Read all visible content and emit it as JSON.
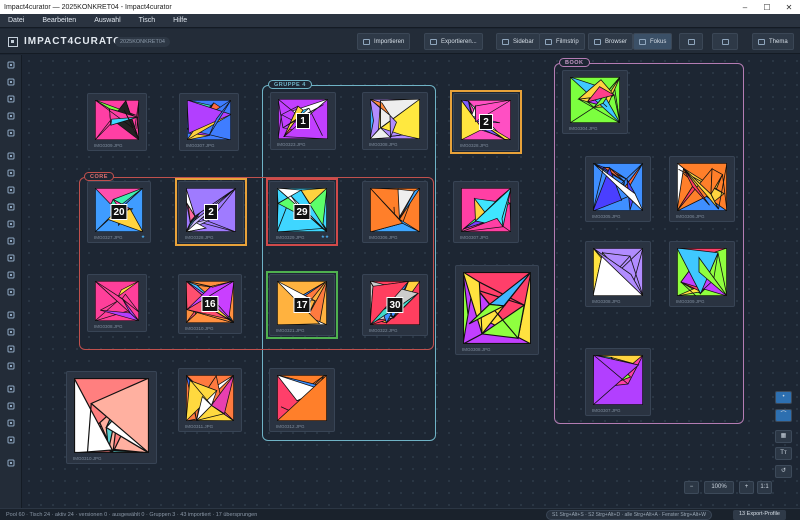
{
  "window": {
    "title": "Impact4curator — 2025KONKRET04 - Impact4curator"
  },
  "menu": [
    "Datei",
    "Bearbeiten",
    "Auswahl",
    "Tisch",
    "Hilfe"
  ],
  "toolbar": {
    "app_name": "IMPACT4CURATOR",
    "project": "2025KONKRET04",
    "import": "Importieren",
    "export": "Exportieren...",
    "views": [
      "Sidebar",
      "Filmstrip",
      "Browser",
      "Fokus"
    ],
    "active_view": "Fokus",
    "theme": "Thema"
  },
  "groups": [
    {
      "label": "GRUPPE 4",
      "color": "#6fb3c6"
    },
    {
      "label": "CORE",
      "color": "#c0504d"
    },
    {
      "label": "BOOK",
      "color": "#b47cb3"
    }
  ],
  "cards": [
    {
      "file": "IMG0309.JPG",
      "palette": [
        "#ff3fa4",
        "#7dff3f",
        "#3fd9ff",
        "#ffe23f",
        "#222222"
      ]
    },
    {
      "file": "IMG0307.JPG",
      "palette": [
        "#3f7dff",
        "#ff6a3f",
        "#ffd13f",
        "#39e0c0",
        "#b23fff"
      ]
    },
    {
      "file": "IMG0323.JPG",
      "badge": "1",
      "palette": [
        "#c23fff",
        "#3fc9ff",
        "#ffd43f",
        "#ff3f6a",
        "#ffffff"
      ]
    },
    {
      "file": "IMG0308.JPG",
      "palette": [
        "#b18cff",
        "#ff8c3f",
        "#ffe83f",
        "#3fb0ff",
        "#eeeeee"
      ]
    },
    {
      "file": "IMG0328.JPG",
      "badge": "2",
      "palette": [
        "#ff4fc3",
        "#7e5cff",
        "#3fd0ff",
        "#ffe43f",
        "#ffffff"
      ]
    },
    {
      "file": "IMG0327.JPG",
      "badge": "20",
      "stars": "★",
      "palette": [
        "#ff4faf",
        "#3ff0b0",
        "#ffd43f",
        "#3f9cff",
        "#ffffff"
      ]
    },
    {
      "file": "IMG0328.JPG",
      "badge": "2",
      "palette": [
        "#9f7bff",
        "#c9b9ff",
        "#3fc4ff",
        "#ff6a9f",
        "#ffffff"
      ]
    },
    {
      "file": "IMG0329.JPG",
      "badge": "29",
      "stars": "★★",
      "palette": [
        "#3fd6ff",
        "#ff3f7a",
        "#ffd23f",
        "#5cff6a",
        "#ffffff"
      ]
    },
    {
      "file": "IMG0306.JPG",
      "palette": [
        "#ff7f2a",
        "#ffc43f",
        "#ff3f3f",
        "#3fa6ff",
        "#eeeeee"
      ]
    },
    {
      "file": "IMG0307.JPG",
      "palette": [
        "#ff3fa4",
        "#ffd43f",
        "#3fe6ff",
        "#7a3fff",
        "#4aff7a"
      ]
    },
    {
      "file": "IMG0308.JPG",
      "palette": [
        "#ff3f9a",
        "#ff9f3f",
        "#ffe03f",
        "#b23fff",
        "#3fffc8"
      ]
    },
    {
      "file": "IMG0310.JPG",
      "badge": "16",
      "palette": [
        "#ff8f3f",
        "#ff4f6f",
        "#ffd93f",
        "#3fb8ff",
        "#c93fff"
      ]
    },
    {
      "file": "IMG0321.JPG",
      "badge": "17",
      "palette": [
        "#ffb23f",
        "#ffe13f",
        "#ff7a3f",
        "#3f8cff",
        "#ffffff"
      ]
    },
    {
      "file": "IMG0322.JPG",
      "badge": "30",
      "palette": [
        "#ff3f5f",
        "#3f8fff",
        "#3fdccc",
        "#ffd13f",
        "#cccccc"
      ]
    },
    {
      "file": "IMG0308.JPG",
      "palette": [
        "#8fff3f",
        "#c23fff",
        "#ffe23f",
        "#3fb6ff",
        "#ff3f6a"
      ]
    },
    {
      "file": "IMG0310.JPG",
      "palette": [
        "#ff7f7f",
        "#ffb0a0",
        "#5acfd0",
        "#3f5fbf",
        "#ffffff"
      ]
    },
    {
      "file": "IMG0311.JPG",
      "palette": [
        "#ff7a3f",
        "#3f70ff",
        "#ffd93f",
        "#e83fb0",
        "#ffffff"
      ]
    },
    {
      "file": "IMG0312.JPG",
      "palette": [
        "#ff7f2a",
        "#3f8fff",
        "#ff3f6a",
        "#ffd43f",
        "#ffffff"
      ]
    },
    {
      "file": "IMG0304.JPG",
      "palette": [
        "#7cff3f",
        "#b23fff",
        "#ffd43f",
        "#3fc8ff",
        "#ff3f8a"
      ]
    },
    {
      "file": "IMG0305.JPG",
      "palette": [
        "#3f8fff",
        "#ffd43f",
        "#ff6a3f",
        "#4a3fff",
        "#ffffff"
      ]
    },
    {
      "file": "IMG0306.JPG",
      "palette": [
        "#ff7f2a",
        "#ffd43f",
        "#3f8fff",
        "#ff3f5f",
        "#ffffff"
      ]
    },
    {
      "file": "IMG0308.JPG",
      "palette": [
        "#b18cff",
        "#ff3fa4",
        "#ffe23f",
        "#3fb6ff",
        "#ffffff"
      ]
    },
    {
      "file": "IMG0309.JPG",
      "palette": [
        "#8fff3f",
        "#c23fff",
        "#ffe23f",
        "#ff3f6a",
        "#3fc8ff"
      ]
    },
    {
      "file": "IMG0307.JPG",
      "palette": [
        "#ffd43f",
        "#ff3fa4",
        "#3fe6ff",
        "#8fff3f",
        "#b23fff"
      ]
    }
  ],
  "zoom": {
    "out": "−",
    "value": "100%",
    "in": "+",
    "one": "1:1"
  },
  "status": {
    "text": "Pool 60 · Tisch 24 · aktiv 24 · versionen 0 · ausgewählt 0 · Gruppen 3 · 43 importiert · 17 übersprungen",
    "hints": "S1 Strg+Alt+S · S2 Strg+Alt+D · alle Strg+Alt+A · Fenster Strg+Alt+W",
    "export_profiles": "13 Export-Profile"
  },
  "colors": {
    "accent": "#4aa8e8",
    "selection_orange": "#e8a23a",
    "selection_red": "#d04a4a",
    "selection_green": "#4fb04f"
  }
}
